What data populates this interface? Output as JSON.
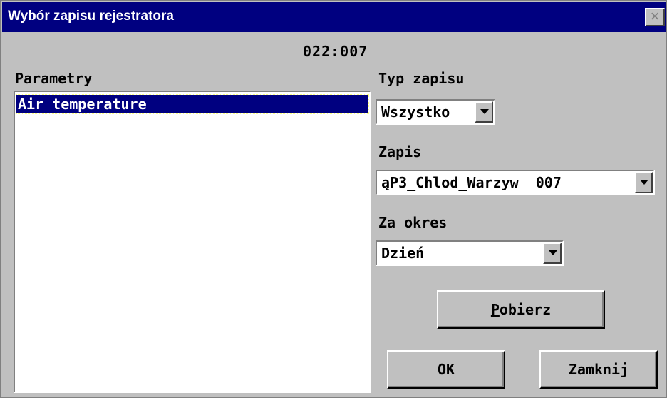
{
  "window": {
    "title": "Wybór zapisu rejestratora",
    "close_icon": "close-icon"
  },
  "record_code": "022:007",
  "parameters": {
    "label": "Parametry",
    "items": [
      "Air temperature"
    ],
    "selected_index": 0
  },
  "record_type": {
    "label": "Typ zapisu",
    "value": "Wszystko"
  },
  "record": {
    "label": "Zapis",
    "value": "ąP3_Chlod_Warzyw  007"
  },
  "period": {
    "label": "Za okres",
    "value": "Dzień"
  },
  "buttons": {
    "fetch_first": "P",
    "fetch_rest": "obierz",
    "ok": "OK",
    "close": "Zamknij"
  },
  "colors": {
    "titlebar": "#000080",
    "window": "#c0c0c0",
    "selection": "#000080"
  }
}
